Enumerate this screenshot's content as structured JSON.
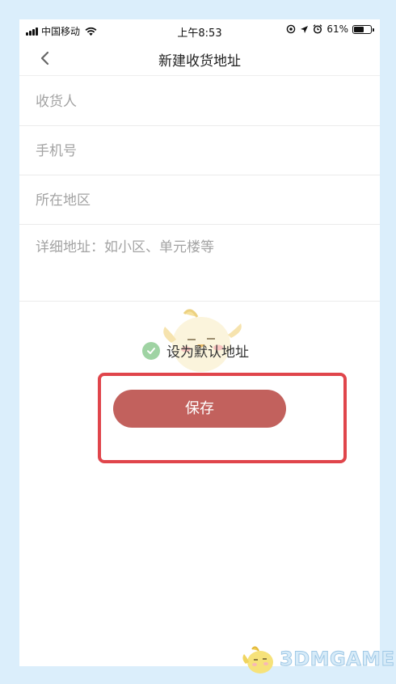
{
  "status_bar": {
    "carrier": "中国移动",
    "time": "上午8:53",
    "battery": "61%",
    "battery_level": 0.61,
    "icons": [
      "signal-icon",
      "wifi-icon",
      "location-lock-icon",
      "location-arrow-icon",
      "alarm-icon",
      "battery-icon"
    ]
  },
  "nav": {
    "title": "新建收货地址",
    "back_icon": "chevron-left-icon"
  },
  "form": {
    "recipient_placeholder": "收货人",
    "phone_placeholder": "手机号",
    "region_placeholder": "所在地区",
    "address_placeholder": "详细地址：如小区、单元楼等"
  },
  "default_address": {
    "label": "设为默认地址",
    "checked": true,
    "icon": "check-circle-icon"
  },
  "save_button": {
    "label": "保存"
  },
  "colors": {
    "save_button": "#c2615d",
    "highlight": "#e0454b",
    "check": "#9fd3a3",
    "background": "#dbeefb"
  },
  "watermark": {
    "text": "3DMGAME"
  }
}
